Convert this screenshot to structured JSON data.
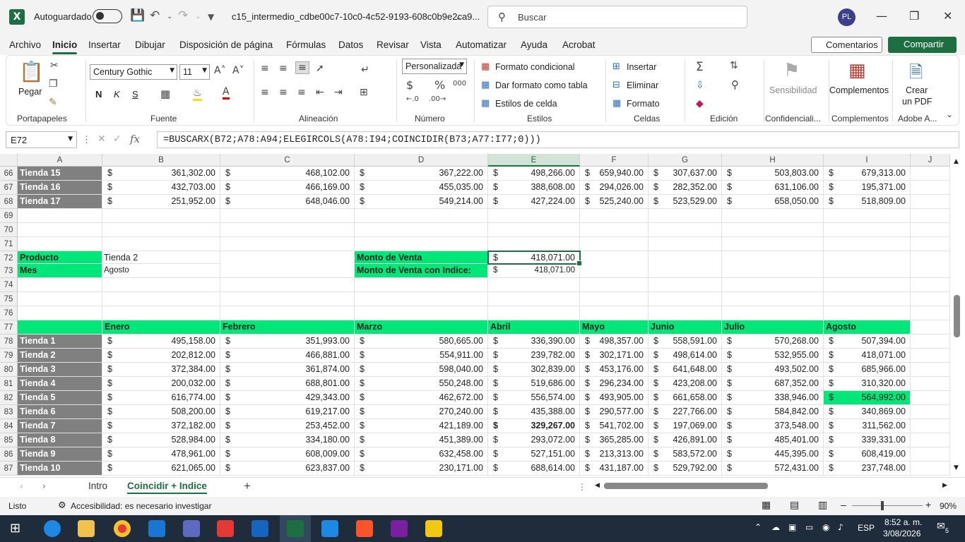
{
  "titlebar": {
    "autosave_label": "Autoguardado",
    "filename": "c15_intermedio_cdbe00c7-10c0-4c52-9193-608c0b9e2ca9...",
    "search_placeholder": "Buscar",
    "avatar_initials": "PL"
  },
  "menu": [
    "Archivo",
    "Inicio",
    "Insertar",
    "Dibujar",
    "Disposición de página",
    "Fórmulas",
    "Datos",
    "Revisar",
    "Vista",
    "Automatizar",
    "Ayuda",
    "Acrobat"
  ],
  "menu_buttons": {
    "comments": "Comentarios",
    "share": "Compartir"
  },
  "ribbon": {
    "paste": "Pegar",
    "clipboard": "Portapapeles",
    "font_name": "Century Gothic",
    "font_size": "11",
    "font_group": "Fuente",
    "bold": "N",
    "italic": "K",
    "underline": "S",
    "alignment_group": "Alineación",
    "number_format": "Personalizada",
    "number_group": "Número",
    "cond_format": "Formato condicional",
    "table_format": "Dar formato como tabla",
    "cell_styles": "Estilos de celda",
    "styles_group": "Estilos",
    "insert": "Insertar",
    "delete": "Eliminar",
    "format": "Formato",
    "cells_group": "Celdas",
    "editing_group": "Edición",
    "sensitivity": "Sensibilidad",
    "confidential_group": "Confidenciali...",
    "addins": "Complementos",
    "addins_group": "Complementos",
    "create_pdf_1": "Crear",
    "create_pdf_2": "un PDF",
    "adobe_group": "Adobe A..."
  },
  "formula": {
    "namebox": "E72",
    "formula": "=BUSCARX(B72;A78:A94;ELEGIRCOLS(A78:I94;COINCIDIR(B73;A77:I77;0)))"
  },
  "columns": [
    "A",
    "B",
    "C",
    "D",
    "E",
    "F",
    "G",
    "H",
    "I",
    "J"
  ],
  "rows_top": [
    {
      "num": "66",
      "store": "Tienda 15",
      "vals": [
        "361,302.00",
        "468,102.00",
        "367,222.00",
        "498,266.00",
        "659,940.00",
        "307,637.00",
        "503,803.00",
        "679,313.00"
      ]
    },
    {
      "num": "67",
      "store": "Tienda 16",
      "vals": [
        "432,703.00",
        "466,169.00",
        "455,035.00",
        "388,608.00",
        "294,026.00",
        "282,352.00",
        "631,106.00",
        "195,371.00"
      ]
    },
    {
      "num": "68",
      "store": "Tienda 17",
      "vals": [
        "251,952.00",
        "648,046.00",
        "549,214.00",
        "427,224.00",
        "525,240.00",
        "523,529.00",
        "658,050.00",
        "518,809.00"
      ]
    }
  ],
  "empty_rows_a": [
    "69",
    "70",
    "71"
  ],
  "lookup": {
    "r72": "72",
    "r73": "73",
    "producto_label": "Producto",
    "producto_value": "Tienda 2",
    "mes_label": "Mes",
    "mes_value": "Agosto",
    "monto_label": "Monto de Venta",
    "monto_value": "418,071.00",
    "monto_idx_label": "Monto de Venta con Indice:",
    "monto_idx_value": "418,071.00"
  },
  "empty_rows_b": [
    "74",
    "75",
    "76"
  ],
  "header_row": {
    "num": "77",
    "months": [
      "Enero",
      "Febrero",
      "Marzo",
      "Abril",
      "Mayo",
      "Junio",
      "Julio",
      "Agosto"
    ]
  },
  "currency": "$",
  "rows_bottom": [
    {
      "num": "78",
      "store": "Tienda 1",
      "vals": [
        "495,158.00",
        "351,993.00",
        "580,665.00",
        "336,390.00",
        "498,357.00",
        "558,591.00",
        "570,268.00",
        "507,394.00"
      ]
    },
    {
      "num": "79",
      "store": "Tienda 2",
      "vals": [
        "202,812.00",
        "466,881.00",
        "554,911.00",
        "239,782.00",
        "302,171.00",
        "498,614.00",
        "532,955.00",
        "418,071.00"
      ]
    },
    {
      "num": "80",
      "store": "Tienda 3",
      "vals": [
        "372,384.00",
        "361,874.00",
        "598,040.00",
        "302,839.00",
        "453,176.00",
        "641,648.00",
        "493,502.00",
        "685,966.00"
      ]
    },
    {
      "num": "81",
      "store": "Tienda 4",
      "vals": [
        "200,032.00",
        "688,801.00",
        "550,248.00",
        "519,686.00",
        "296,234.00",
        "423,208.00",
        "687,352.00",
        "310,320.00"
      ]
    },
    {
      "num": "82",
      "store": "Tienda 5",
      "vals": [
        "616,774.00",
        "429,343.00",
        "462,672.00",
        "556,574.00",
        "493,905.00",
        "661,658.00",
        "338,946.00",
        "564,992.00"
      ]
    },
    {
      "num": "83",
      "store": "Tienda 6",
      "vals": [
        "508,200.00",
        "619,217.00",
        "270,240.00",
        "435,388.00",
        "290,577.00",
        "227,766.00",
        "584,842.00",
        "340,869.00"
      ]
    },
    {
      "num": "84",
      "store": "Tienda 7",
      "vals": [
        "372,182.00",
        "253,452.00",
        "421,189.00",
        "329,267.00",
        "541,702.00",
        "197,069.00",
        "373,548.00",
        "311,562.00"
      ]
    },
    {
      "num": "85",
      "store": "Tienda 8",
      "vals": [
        "528,984.00",
        "334,180.00",
        "451,389.00",
        "293,072.00",
        "365,285.00",
        "426,891.00",
        "485,401.00",
        "339,331.00"
      ]
    },
    {
      "num": "86",
      "store": "Tienda 9",
      "vals": [
        "478,961.00",
        "608,009.00",
        "632,458.00",
        "527,151.00",
        "213,313.00",
        "583,572.00",
        "445,395.00",
        "608,419.00"
      ]
    },
    {
      "num": "87",
      "store": "Tienda 10",
      "vals": [
        "621,065.00",
        "623,837.00",
        "230,171.00",
        "688,614.00",
        "431,187.00",
        "529,792.00",
        "572,431.00",
        "237,748.00"
      ]
    }
  ],
  "sheets": [
    "Intro",
    "Coincidir + Indice"
  ],
  "status": {
    "ready": "Listo",
    "accessibility": "Accesibilidad: es necesario investigar",
    "zoom": "90%"
  },
  "taskbar": {
    "lang": "ESP",
    "time": "8:52 a. m.",
    "date": "3/08/2026",
    "notif": "5"
  },
  "colors": {
    "accent": "#1d6f42",
    "highlight": "#00e678",
    "store_col": "#808080"
  }
}
